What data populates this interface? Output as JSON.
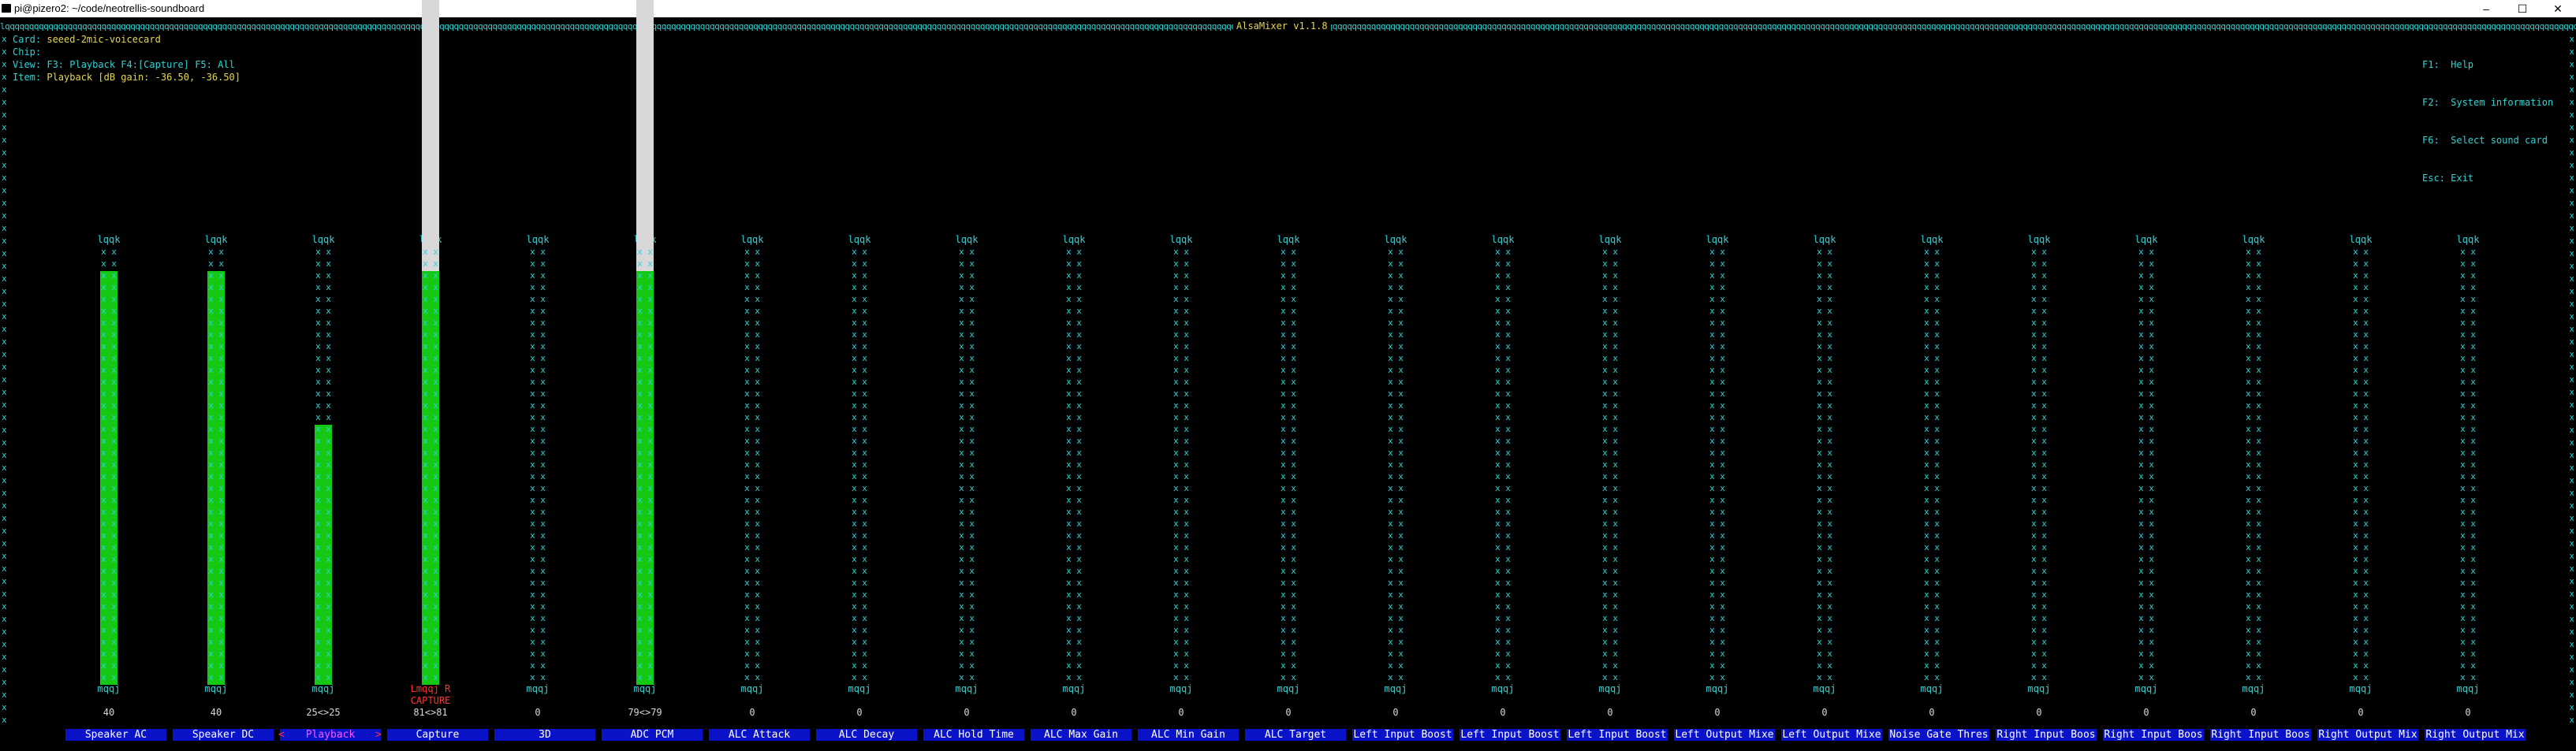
{
  "window": {
    "title": "pi@pizero2: ~/code/neotrellis-soundboard"
  },
  "app": {
    "title": "AlsaMixer v1.1.8"
  },
  "info": {
    "card_label": "Card:",
    "card_value": "seeed-2mic-voicecard",
    "chip_label": "Chip:",
    "chip_value": "",
    "view_label": "View:",
    "view_value": "F3: Playback  F4:[Capture] F5: All",
    "item_label": "Item:",
    "item_value": "Playback [dB gain: -36.50, -36.50]"
  },
  "help": [
    "F1:  Help",
    "F2:  System information",
    "F6:  Select sound card",
    "Esc: Exit"
  ],
  "channels": [
    {
      "name": "Speaker AC",
      "value": "40",
      "level": 35,
      "white": 0,
      "bottom": "mqqj",
      "capture": ""
    },
    {
      "name": "Speaker DC",
      "value": "40",
      "level": 35,
      "white": 0,
      "bottom": "mqqj",
      "capture": ""
    },
    {
      "name": "Playback",
      "value": "25<>25",
      "level": 22,
      "white": 0,
      "bottom": "mqqj",
      "capture": "",
      "selected": true
    },
    {
      "name": "Capture",
      "value": "81<>81",
      "level": 35,
      "white": 35,
      "bottom": "Lmqqj R",
      "capture": "CAPTURE"
    },
    {
      "name": "3D",
      "value": "0",
      "level": 0,
      "white": 0,
      "bottom": "mqqj",
      "capture": ""
    },
    {
      "name": "ADC PCM",
      "value": "79<>79",
      "level": 35,
      "white": 33,
      "bottom": "mqqj",
      "capture": ""
    },
    {
      "name": "ALC Attack",
      "value": "0",
      "level": 0,
      "white": 0,
      "bottom": "mqqj",
      "capture": ""
    },
    {
      "name": "ALC Decay",
      "value": "0",
      "level": 0,
      "white": 0,
      "bottom": "mqqj",
      "capture": ""
    },
    {
      "name": "ALC Hold Time",
      "value": "0",
      "level": 0,
      "white": 0,
      "bottom": "mqqj",
      "capture": ""
    },
    {
      "name": "ALC Max Gain",
      "value": "0",
      "level": 0,
      "white": 0,
      "bottom": "mqqj",
      "capture": ""
    },
    {
      "name": "ALC Min Gain",
      "value": "0",
      "level": 0,
      "white": 0,
      "bottom": "mqqj",
      "capture": ""
    },
    {
      "name": "ALC Target",
      "value": "0",
      "level": 0,
      "white": 0,
      "bottom": "mqqj",
      "capture": ""
    },
    {
      "name": "Left Input Boost",
      "value": "0",
      "level": 0,
      "white": 0,
      "bottom": "mqqj",
      "capture": ""
    },
    {
      "name": "Left Input Boost",
      "value": "0",
      "level": 0,
      "white": 0,
      "bottom": "mqqj",
      "capture": ""
    },
    {
      "name": "Left Input Boost",
      "value": "0",
      "level": 0,
      "white": 0,
      "bottom": "mqqj",
      "capture": ""
    },
    {
      "name": "Left Output Mixe",
      "value": "0",
      "level": 0,
      "white": 0,
      "bottom": "mqqj",
      "capture": ""
    },
    {
      "name": "Left Output Mixe",
      "value": "0",
      "level": 0,
      "white": 0,
      "bottom": "mqqj",
      "capture": ""
    },
    {
      "name": "Noise Gate Thres",
      "value": "0",
      "level": 0,
      "white": 0,
      "bottom": "mqqj",
      "capture": ""
    },
    {
      "name": "Right Input Boos",
      "value": "0",
      "level": 0,
      "white": 0,
      "bottom": "mqqj",
      "capture": ""
    },
    {
      "name": "Right Input Boos",
      "value": "0",
      "level": 0,
      "white": 0,
      "bottom": "mqqj",
      "capture": ""
    },
    {
      "name": "Right Input Boos",
      "value": "0",
      "level": 0,
      "white": 0,
      "bottom": "mqqj",
      "capture": ""
    },
    {
      "name": "Right Output Mix",
      "value": "0",
      "level": 0,
      "white": 0,
      "bottom": "mqqj",
      "capture": ""
    },
    {
      "name": "Right Output Mix",
      "value": "0",
      "level": 0,
      "white": 0,
      "bottom": "mqqj",
      "capture": ""
    }
  ],
  "colors": {
    "cyan": "#2fd3d3",
    "yellow": "#e6d84d",
    "green": "#14c814",
    "blue": "#0a13c8",
    "red": "#ff3333",
    "magenta": "#ff55ff"
  }
}
